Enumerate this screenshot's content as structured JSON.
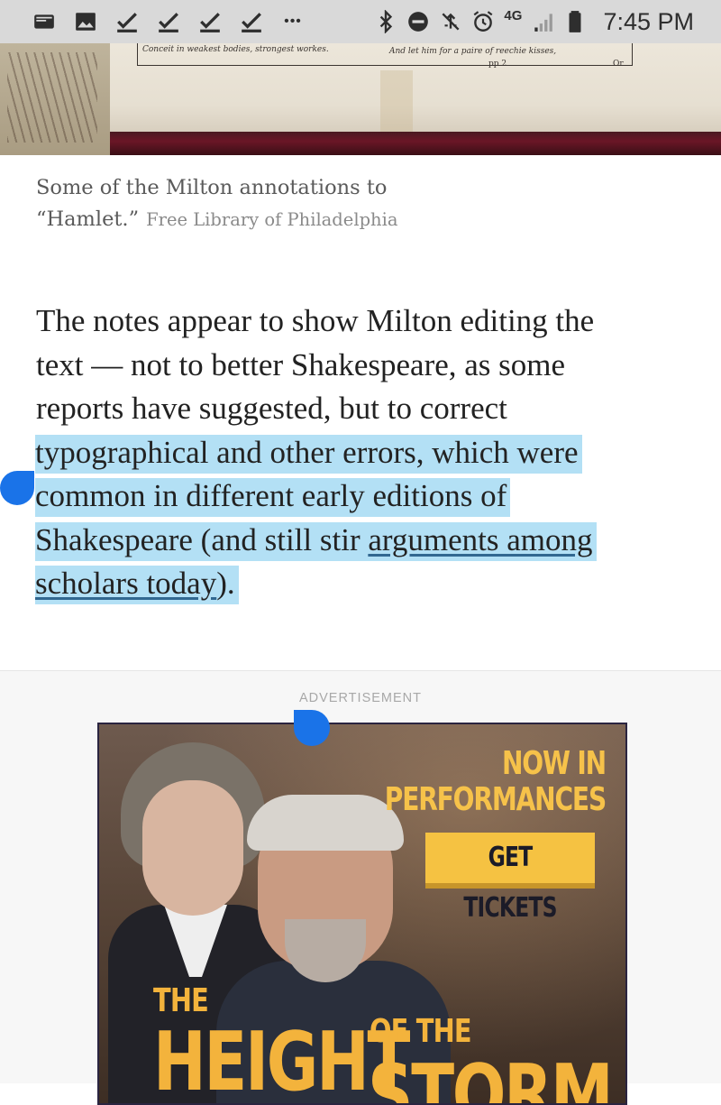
{
  "status_bar": {
    "time": "7:45 PM",
    "network": "4G",
    "left_icons": [
      "email-icon",
      "image-icon",
      "check-icon",
      "check-icon",
      "check-icon",
      "check-icon",
      "more-dots-icon"
    ],
    "right_icons": [
      "bluetooth-icon",
      "do-not-disturb-icon",
      "signal-off-icon",
      "alarm-icon",
      "mobile-data-icon",
      "battery-icon"
    ],
    "more": "•••"
  },
  "photo": {
    "text_left": "Conceit in weakest bodies, strongest workes.",
    "text_right": "And let him for a paire of reechie kisses,",
    "page_mark": "pp 2",
    "catchword": "Or"
  },
  "caption": {
    "text": "Some of the Milton annotations to “Hamlet.”",
    "line1": "Some of the Milton annotations to",
    "line2": "“Hamlet.”",
    "credit": "Free Library of Philadelphia"
  },
  "article": {
    "line1": "The notes appear to show Milton editing the",
    "line2": "text — not to better Shakespeare, as some",
    "line3": "reports have suggested, but to correct",
    "line4": "typographical and other errors, which were",
    "line5": "common in different early editions of",
    "line6_text": "Shakespeare (and still stir ",
    "line6_link": "arguments among",
    "line7_link": "scholars today",
    "line7_end": ")."
  },
  "ad": {
    "label": "ADVERTISEMENT",
    "headline_1": "NOW IN",
    "headline_2": "PERFORMANCES",
    "cta": "GET TICKETS",
    "title_the": "THE",
    "title_height": "HEIGHT",
    "title_of_the": "OF THE",
    "title_storm": "STORM"
  },
  "colors": {
    "status_bar_bg": "#d9d9d9",
    "selection": "#b3e0f5",
    "handle": "#1a73e8",
    "ad_gold": "#f3b33c"
  }
}
